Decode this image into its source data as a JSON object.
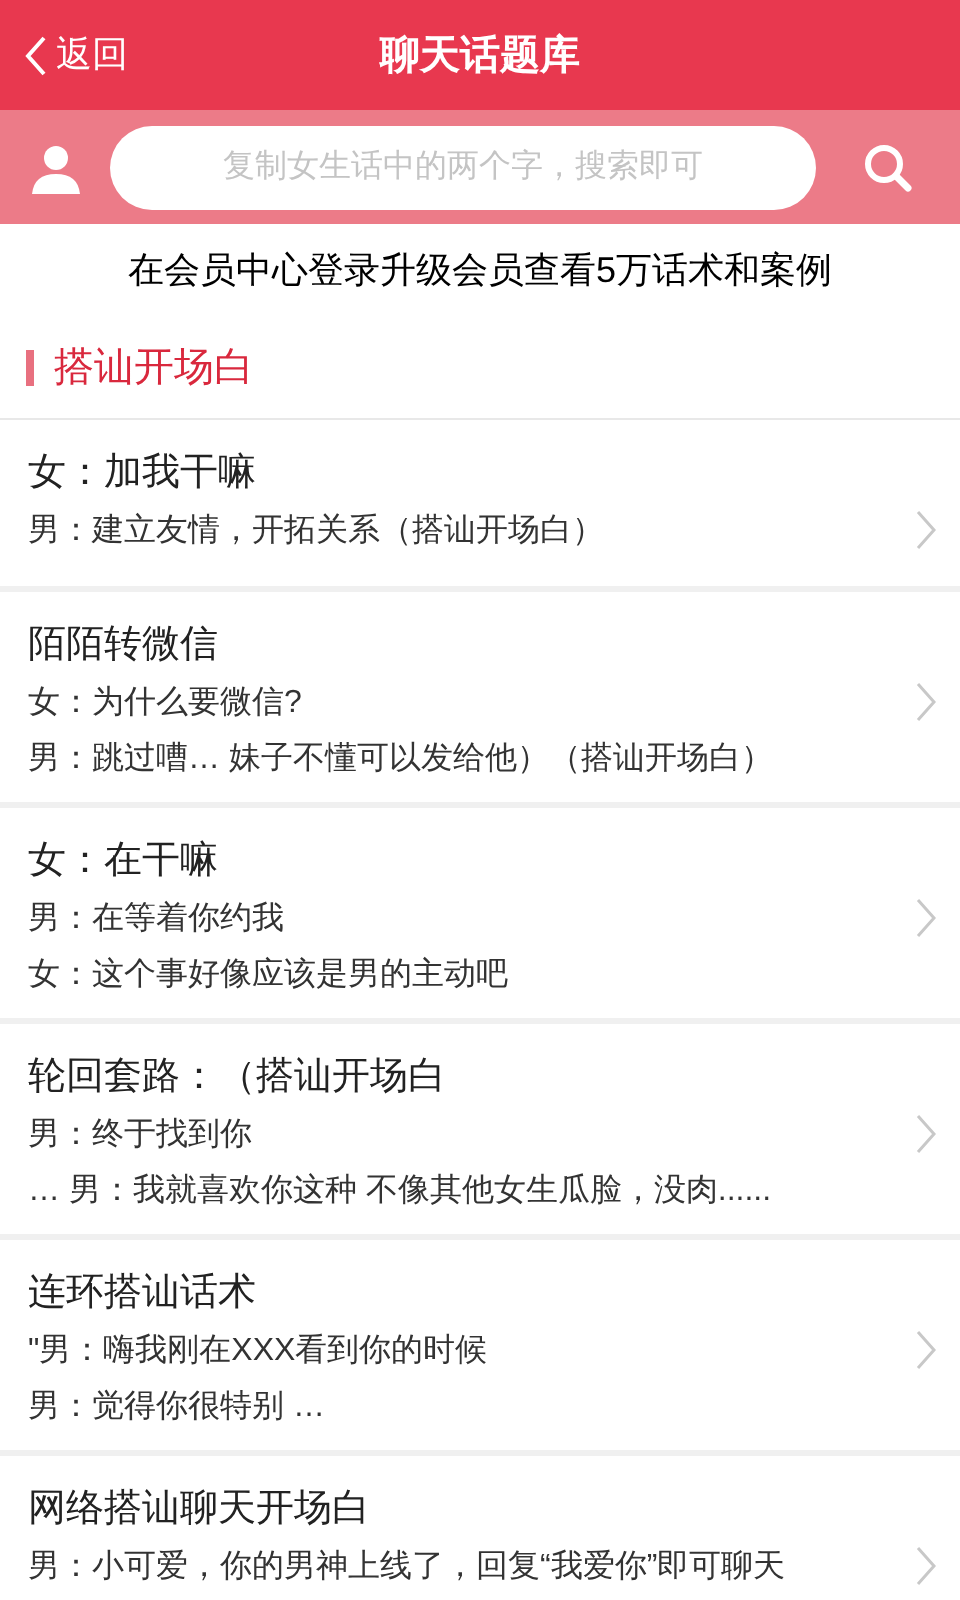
{
  "header": {
    "back": "返回",
    "title": "聊天话题库"
  },
  "search": {
    "placeholder": "复制女生话中的两个字，搜索即可"
  },
  "notice": "在会员中心登录升级会员查看5万话术和案例",
  "section": {
    "title": "搭讪开场白"
  },
  "entries": [
    {
      "title": "女：加我干嘛",
      "lines": [
        "男：建立友情，开拓关系（搭讪开场白）"
      ]
    },
    {
      "title": "陌陌转微信",
      "lines": [
        "女：为什么要微信?",
        "男：跳过嘈… 妹子不懂可以发给他）（搭讪开场白）"
      ]
    },
    {
      "title": "女：在干嘛",
      "lines": [
        "男：在等着你约我",
        "女：这个事好像应该是男的主动吧"
      ]
    },
    {
      "title": "轮回套路：（搭讪开场白",
      "lines": [
        "男：终于找到你",
        "… 男：我就喜欢你这种 不像其他女生瓜脸，没肉......"
      ]
    },
    {
      "title": "连环搭讪话术",
      "lines": [
        "\"男：嗨我刚在XXX看到你的时候",
        "男：觉得你很特别 …"
      ]
    },
    {
      "title": "网络搭讪聊天开场白",
      "lines": [
        "男：小可爱，你的男神上线了，回复“我爱你”即可聊天"
      ]
    }
  ]
}
